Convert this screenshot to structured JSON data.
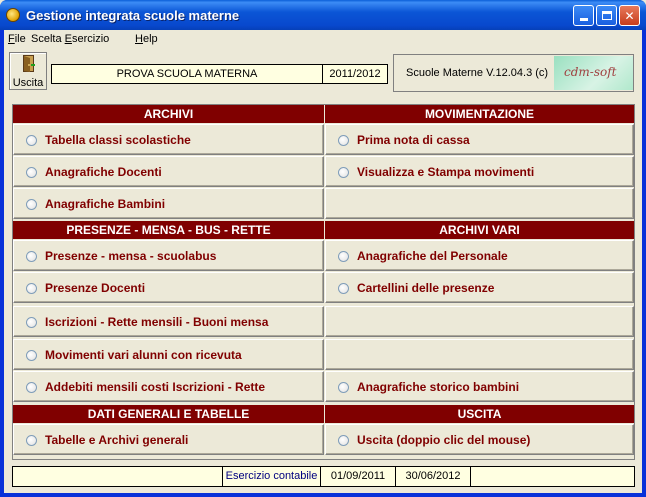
{
  "window": {
    "title": "Gestione integrata scuole materne",
    "app_icon": "app-icon"
  },
  "menu": [
    {
      "label": "File",
      "underline": "F",
      "rest": "ile"
    },
    {
      "label": "Scelta Esercizio",
      "pre": "Scelta ",
      "underline": "E",
      "rest": "sercizio"
    },
    {
      "label": "Help",
      "underline": "H",
      "rest": "elp"
    }
  ],
  "toolbar": {
    "exit_label": "Uscita",
    "exit_icon": "door-exit-icon"
  },
  "school_name": "PROVA SCUOLA MATERNA",
  "school_year": "2011/2012",
  "version": "Scuole Materne V.12.04.3 (c)",
  "logo_text": "cdm-soft",
  "sections": {
    "archivi": {
      "title": "ARCHIVI",
      "items": [
        "Tabella classi scolastiche",
        "Anagrafiche Docenti",
        "Anagrafiche Bambini"
      ]
    },
    "movimentazione": {
      "title": "MOVIMENTAZIONE",
      "items": [
        "Prima nota di cassa",
        "Visualizza e Stampa movimenti",
        ""
      ]
    },
    "presenze": {
      "title": "PRESENZE - MENSA - BUS - RETTE",
      "items": [
        "Presenze - mensa - scuolabus",
        "Presenze Docenti",
        "Iscrizioni - Rette mensili - Buoni mensa",
        "Movimenti vari alunni con ricevuta",
        "Addebiti mensili costi Iscrizioni - Rette"
      ]
    },
    "archivi_vari": {
      "title": "ARCHIVI VARI",
      "items": [
        "Anagrafiche del Personale",
        "Cartellini delle presenze",
        "",
        "",
        "Anagrafiche storico bambini"
      ]
    },
    "dati_generali": {
      "title": "DATI GENERALI E TABELLE",
      "items": [
        "Tabelle e Archivi generali"
      ]
    },
    "uscita": {
      "title": "USCITA",
      "items": [
        "Uscita (doppio clic del mouse)"
      ]
    }
  },
  "status": {
    "label": "Esercizio contabile",
    "start_date": "01/09/2011",
    "end_date": "30/06/2012"
  },
  "colors": {
    "header_bg": "#800000",
    "label_text": "#800000",
    "field_bg": "#ffffe1",
    "window_bg": "#ece9d8"
  }
}
